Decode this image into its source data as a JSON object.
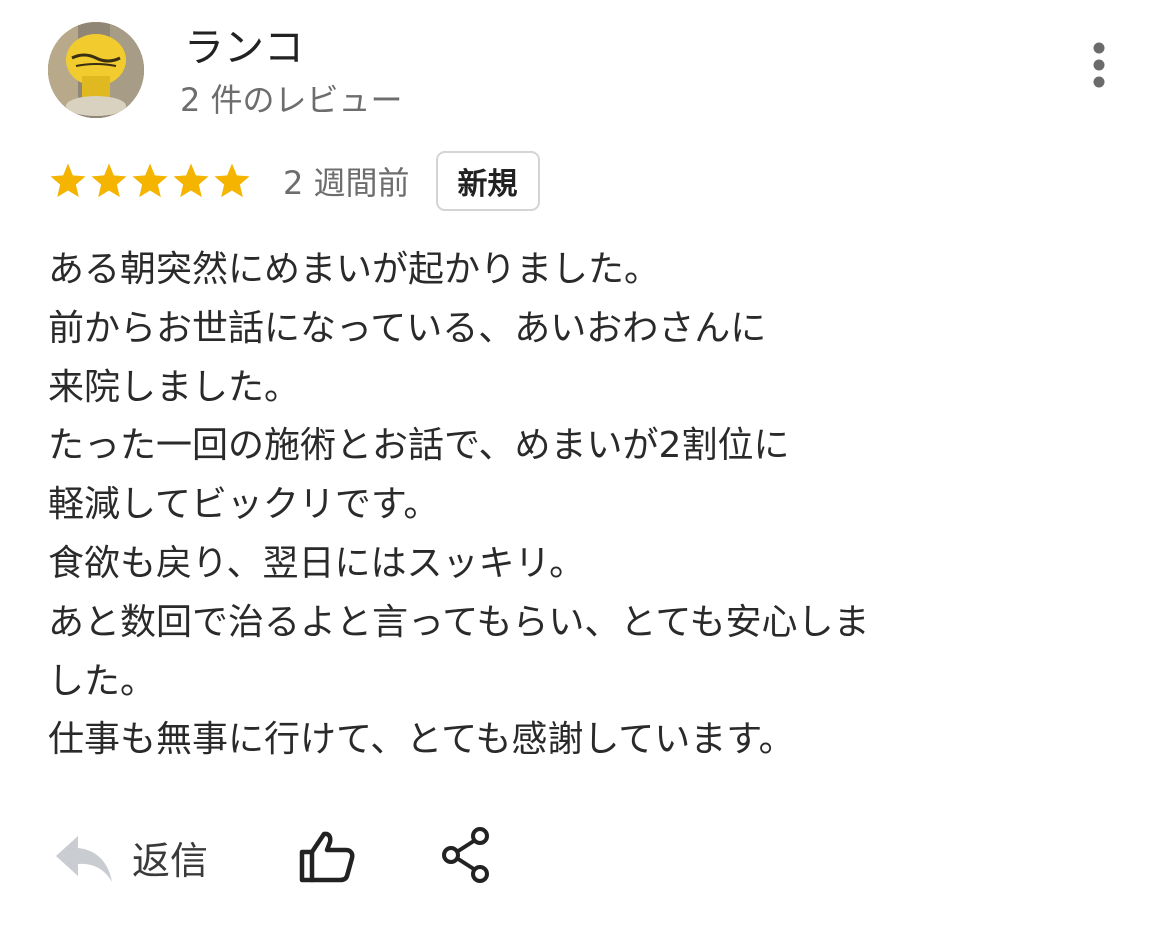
{
  "reviewer": {
    "name": "ランコ",
    "review_count": "2 件のレビュー"
  },
  "rating": {
    "stars": 5,
    "max_stars": 5,
    "time_ago": "2 週間前",
    "badge": "新規"
  },
  "review": {
    "lines": [
      "ある朝突然にめまいが起かりました。",
      "前からお世話になっている、あいおわさんに",
      "来院しました。",
      "たった一回の施術とお話で、めまいが2割位に",
      "軽減してビックリです。",
      "食欲も戻り、翌日にはスッキリ。",
      "あと数回で治るよと言ってもらい、とても安心しま",
      "した。",
      "仕事も無事に行けて、とても感謝しています。"
    ]
  },
  "actions": {
    "reply_label": "返信",
    "reply_icon": "reply-arrow-icon",
    "like_icon": "thumbs-up-icon",
    "share_icon": "share-icon"
  },
  "colors": {
    "star": "#f4b400",
    "text": "#2a2a2a",
    "muted": "#6d6d6d",
    "badge_border": "#d4d4d4",
    "reply_icon": "#c9cdd1"
  }
}
